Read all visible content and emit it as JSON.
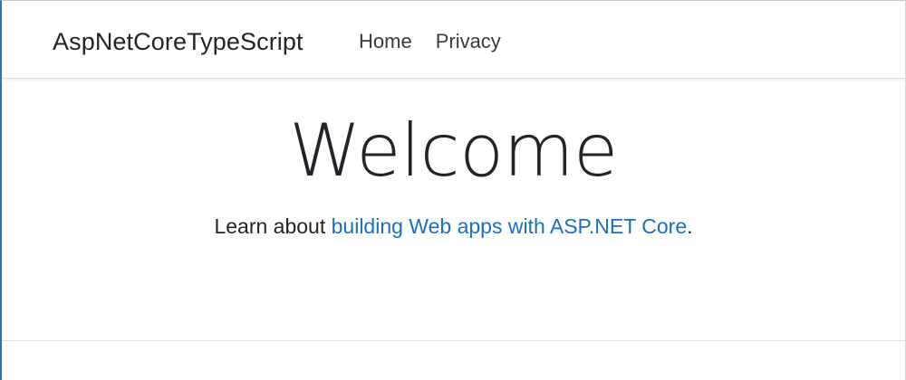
{
  "header": {
    "brand": "AspNetCoreTypeScript",
    "nav": [
      {
        "label": "Home"
      },
      {
        "label": "Privacy"
      }
    ]
  },
  "main": {
    "title": "Welcome",
    "lead_prefix": "Learn about ",
    "lead_link": "building Web apps with ASP.NET Core",
    "lead_suffix": "."
  },
  "colors": {
    "link": "#1b6ec2",
    "text": "#212529",
    "window_border": "#2a73b8"
  }
}
